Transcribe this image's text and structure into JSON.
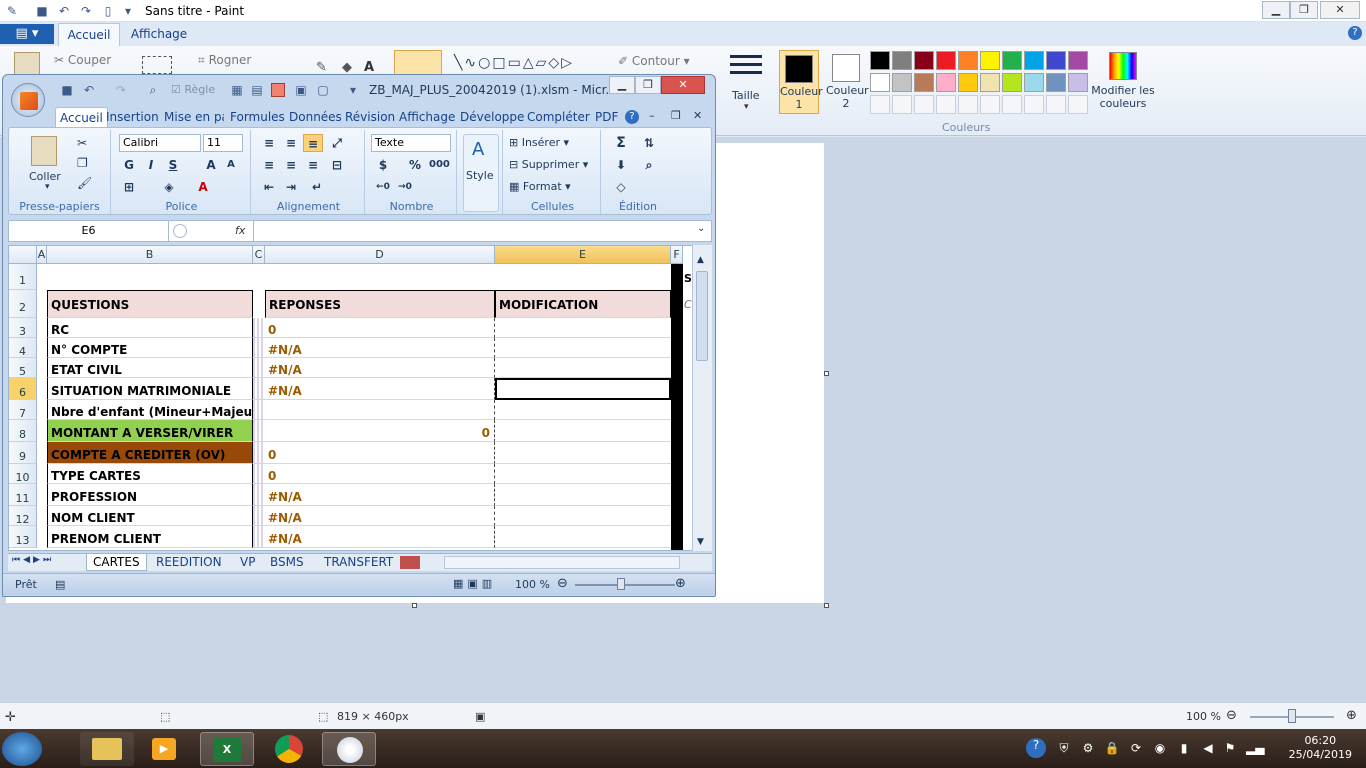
{
  "paint": {
    "title": "Sans titre - Paint",
    "tabs": {
      "file": "▤ ▾",
      "home": "Accueil",
      "view": "Affichage"
    },
    "clipboard": {
      "cut": "Couper"
    },
    "image": {
      "crop": "Rogner"
    },
    "shapes": {
      "outline": "Contour"
    },
    "size_label": "Taille",
    "color1_label": "Couleur 1",
    "color2_label": "Couleur 2",
    "colors_group_label": "Couleurs",
    "edit_colors_label": "Modifier les couleurs",
    "palette": [
      "#000000",
      "#7f7f7f",
      "#880015",
      "#ed1c24",
      "#ff7f27",
      "#fff200",
      "#22b14c",
      "#00a2e8",
      "#3f48cc",
      "#a349a4",
      "#ffffff",
      "#c3c3c3",
      "#b97a57",
      "#ffaec9",
      "#ffc90e",
      "#efe4b0",
      "#b5e61d",
      "#99d9ea",
      "#7092be",
      "#c8bfe7"
    ],
    "status": {
      "canvas_size": "819 × 460px",
      "zoom": "100 %"
    }
  },
  "excel": {
    "title": "ZB_MAJ_PLUS_20042019 (1).xlsm - Micr...",
    "qat_rule": "Règle",
    "tabs": [
      "Accueil",
      "Insertion",
      "Mise en pa",
      "Formules",
      "Données",
      "Révision",
      "Affichage",
      "Développer",
      "Compléter",
      "PDF"
    ],
    "ribbon": {
      "paste": "Coller",
      "clipboard_group": "Presse-papiers",
      "font_name": "Calibri",
      "font_size": "11",
      "bold": "G",
      "italic": "I",
      "underline": "S",
      "font_group": "Police",
      "alignment_group": "Alignement",
      "number_format": "Texte",
      "percent": "%",
      "thousands": "000",
      "number_group": "Nombre",
      "style": "Style",
      "insert": "Insérer",
      "delete": "Supprimer",
      "format": "Format",
      "cells_group": "Cellules",
      "sum": "Σ",
      "edit_group": "Édition"
    },
    "name_box": "E6",
    "fx": "fx",
    "columns": [
      "A",
      "B",
      "C",
      "D",
      "E",
      "F"
    ],
    "header_row": {
      "questions": "QUESTIONS",
      "reponses": "REPONSES",
      "modification": "MODIFICATION"
    },
    "rows": [
      {
        "num": "1",
        "q": "",
        "r": ""
      },
      {
        "num": "2",
        "q": "",
        "r": ""
      },
      {
        "num": "3",
        "q": "RC",
        "r": "0"
      },
      {
        "num": "4",
        "q": "N° COMPTE",
        "r": "#N/A"
      },
      {
        "num": "5",
        "q": "ETAT CIVIL",
        "r": "#N/A"
      },
      {
        "num": "6",
        "q": "SITUATION MATRIMONIALE",
        "r": "#N/A"
      },
      {
        "num": "7",
        "q": "Nbre d'enfant (Mineur+Majeur)",
        "r": ""
      },
      {
        "num": "8",
        "q": "MONTANT A VERSER/VIRER",
        "r": "0"
      },
      {
        "num": "9",
        "q": "COMPTE A CREDITER (OV)",
        "r": "0"
      },
      {
        "num": "10",
        "q": "TYPE CARTES",
        "r": "0"
      },
      {
        "num": "11",
        "q": "PROFESSION",
        "r": "#N/A"
      },
      {
        "num": "12",
        "q": "NOM CLIENT",
        "r": "#N/A"
      },
      {
        "num": "13",
        "q": "PRENOM CLIENT",
        "r": "#N/A"
      }
    ],
    "side_text_f1": "SA",
    "side_text_f2": "Cl",
    "sheet_tabs": [
      "CARTES",
      "REEDITION",
      "VP",
      "BSMS",
      "TRANSFERT"
    ],
    "status_ready": "Prêt",
    "zoom": "100 %",
    "colors": {
      "green_cell": "#92d050",
      "brown_cell": "#984807",
      "header_fill": "#f2dcdb"
    }
  },
  "taskbar": {
    "time": "06:20",
    "date": "25/04/2019"
  }
}
